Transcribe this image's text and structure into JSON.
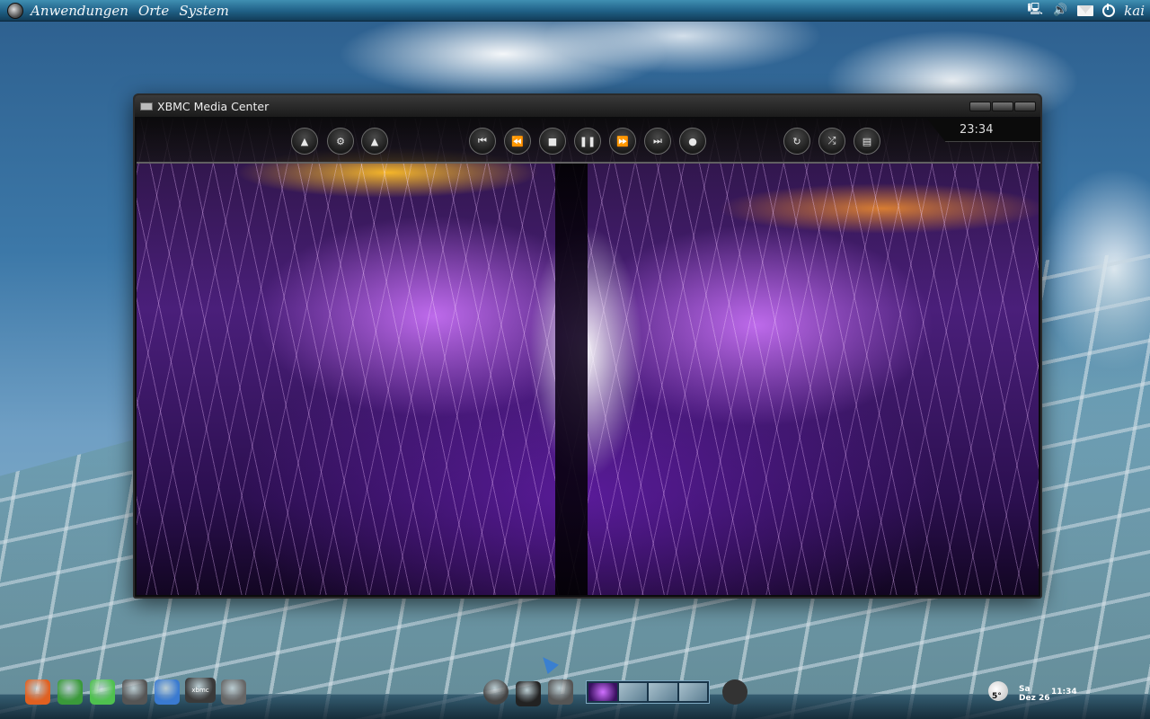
{
  "top_panel": {
    "menus": [
      "Anwendungen",
      "Orte",
      "System"
    ],
    "user": "kai"
  },
  "window": {
    "title": "XBMC Media Center",
    "clock": "23:34",
    "controls_left": [
      {
        "name": "visualisation",
        "glyph": "▲"
      },
      {
        "name": "settings",
        "glyph": "⚙"
      },
      {
        "name": "presets",
        "glyph": "▲"
      }
    ],
    "transport": [
      {
        "name": "previous",
        "glyph": "⏮"
      },
      {
        "name": "rewind",
        "glyph": "⏪"
      },
      {
        "name": "stop",
        "glyph": "■"
      },
      {
        "name": "pause",
        "glyph": "❚❚"
      },
      {
        "name": "fast-forward",
        "glyph": "⏩"
      },
      {
        "name": "next",
        "glyph": "⏭"
      },
      {
        "name": "record",
        "glyph": "●"
      }
    ],
    "controls_right": [
      {
        "name": "repeat",
        "glyph": "↻"
      },
      {
        "name": "shuffle",
        "glyph": "⤮"
      },
      {
        "name": "info",
        "glyph": "▤"
      }
    ]
  },
  "dock": {
    "apps": [
      {
        "name": "firefox",
        "color": "#e06020"
      },
      {
        "name": "swiftfox",
        "color": "#3a9a3a"
      },
      {
        "name": "emerald",
        "color": "#4fc14f"
      },
      {
        "name": "camera",
        "color": "#555555"
      },
      {
        "name": "chromium",
        "color": "#3a7ad0"
      },
      {
        "name": "xbmc",
        "color": "#3a3a3a",
        "label": "xbmc"
      },
      {
        "name": "drive",
        "color": "#666666"
      }
    ],
    "center": [
      {
        "name": "ubuntu-menu",
        "color": "#444444"
      },
      {
        "name": "show-desktop",
        "color": "#222222"
      },
      {
        "name": "box",
        "color": "#555555"
      }
    ],
    "weather_temp": "5°",
    "day": "Sa",
    "date": "Dez 26",
    "time": "11:34"
  }
}
